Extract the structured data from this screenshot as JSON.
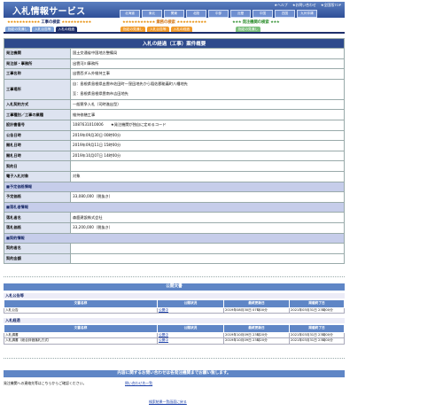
{
  "header": {
    "logo": "入札情報サービス",
    "top_links": [
      "★ヘルプ",
      "★お問い合わせ",
      "★全国版TOP"
    ],
    "regions": [
      "北海道",
      "東北",
      "関東",
      "北陸",
      "中部",
      "近畿",
      "中国",
      "四国",
      "九州沖縄"
    ]
  },
  "sections": [
    {
      "label": "工事の検索",
      "color": "#1e2f6b"
    },
    {
      "label": "業務の検索",
      "color": "#d4791a"
    },
    {
      "label": "発注機関の検索",
      "color": "#2f8f2f"
    }
  ],
  "tabs": {
    "koji": [
      "指定の見通し",
      "入札公告等",
      "入札の経過"
    ],
    "gyomu": [
      "指定の見通し",
      "入札公告等",
      "入札の経過"
    ],
    "kikan": [
      "指定の見通し"
    ]
  },
  "detail": {
    "title": "入札の経過（工事）案件概要",
    "rows": [
      {
        "k": "発注機関",
        "v": "国土交通省中国地方整備局"
      },
      {
        "k": "発注部・事務所",
        "v": "出雲河川事務所"
      },
      {
        "k": "工事名称",
        "v": "出雲西ダム外維持工事"
      },
      {
        "k": "工事場所",
        "v": "自：島根県島根県出雲市佐田町一窪田地先から稲佐郡能義町八幡地先",
        "v2": "至：島根県島根県雲南市吉田地先"
      },
      {
        "k": "入札契約方式",
        "v": "一般競争入札（司時進出型）"
      },
      {
        "k": "工事種別／工事の業種",
        "v": "維持修繕工事"
      },
      {
        "k": "設計書番号",
        "v": "1087631010006　　★発注機関が独自に定めるコード"
      },
      {
        "k": "公告日時",
        "v": "2019年09月30日 00時00分"
      },
      {
        "k": "開札日時",
        "v": "2019年09月11日 15時00分"
      },
      {
        "k": "開札日時",
        "v": "2019年10月07日 14時00分"
      },
      {
        "k": "契約日",
        "v": ""
      },
      {
        "k": "電子入札対象",
        "v": "対象"
      }
    ],
    "sec_yotei": "■予定価格情報",
    "yotei_rows": [
      {
        "k": "予定価格",
        "v": "33,080,000（税抜き）"
      }
    ],
    "sec_rakusatsu": "■落札者情報",
    "rakusatsu_rows": [
      {
        "k": "落札者名",
        "v": "森鹿建設株式会社"
      },
      {
        "k": "落札価格",
        "v": "33,200,000（税抜き）"
      }
    ],
    "sec_keiyaku": "■契約情報",
    "keiyaku_rows": [
      {
        "k": "契約者名",
        "v": ""
      },
      {
        "k": "契約金額",
        "v": ""
      }
    ]
  },
  "public_docs": {
    "title": "公開文書",
    "group1": {
      "label": "入札公告等",
      "headers": [
        "文書名称",
        "公開状況",
        "最終更新日",
        "掲載終了日"
      ],
      "rows": [
        [
          "入札公告",
          "公開中",
          "2019年08月30日 07時00分",
          "2021年03月31日 23時00分"
        ]
      ]
    },
    "group2": {
      "label": "入札経過",
      "headers": [
        "文書名称",
        "公開状況",
        "最終更新日",
        "掲載終了日"
      ],
      "rows": [
        [
          "入札調書",
          "公開中",
          "2019年10月09日 23時20分",
          "2021年03月31日 23時00分"
        ],
        [
          "入札調書（総合評価落札方式）",
          "公開中",
          "2019年10月09日 23時20分",
          "2021年03月31日 23時00分"
        ]
      ]
    }
  },
  "contact": {
    "title": "内容に関するお問い合わせは各発注機関までお願い致します。",
    "text": "発注機関への連絡先等はこちらからご確認ください。",
    "link": "問い合わせ先一覧"
  },
  "back_link": "検索結果一覧画面に戻る"
}
